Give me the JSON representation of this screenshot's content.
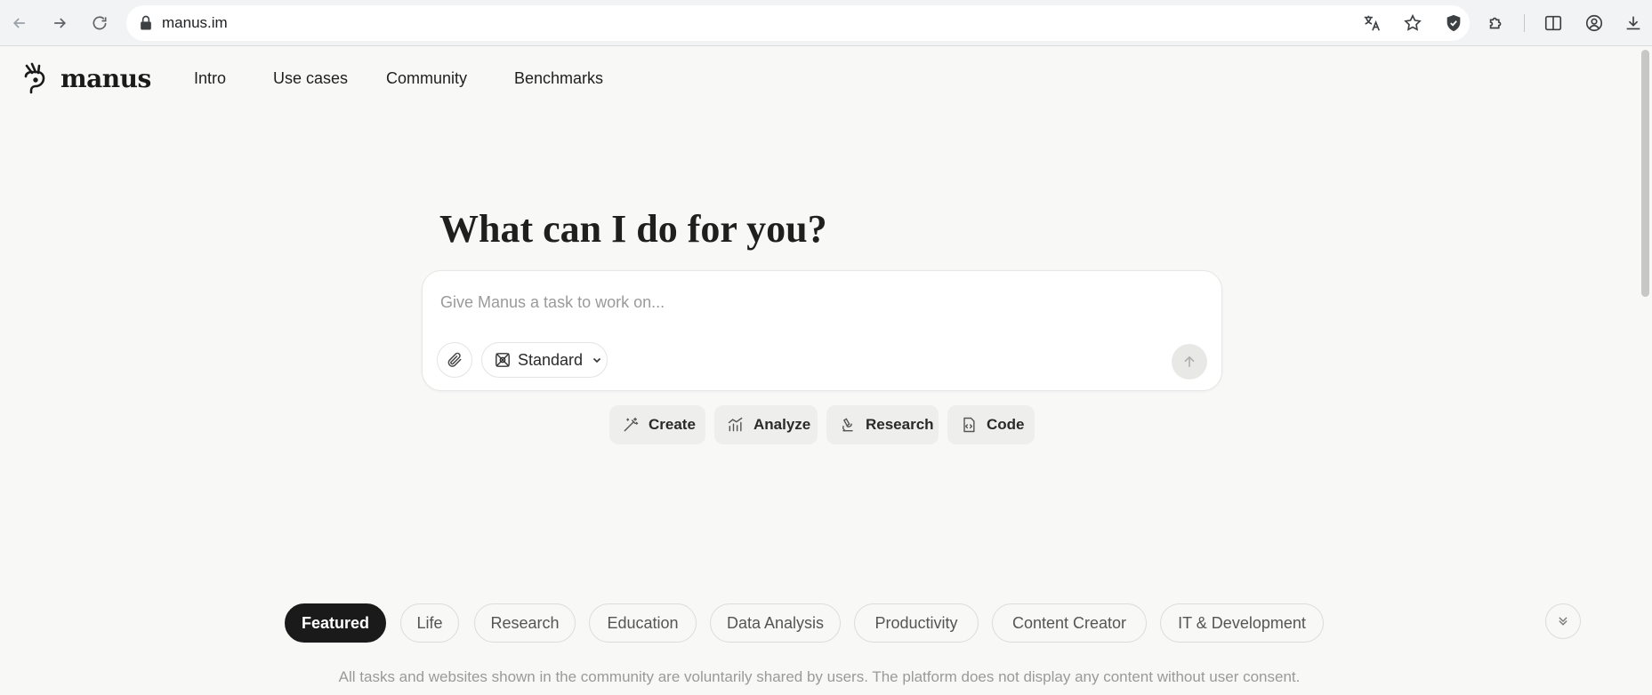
{
  "browser": {
    "url": "manus.im"
  },
  "header": {
    "logo_text": "manus",
    "nav": [
      {
        "label": "Intro"
      },
      {
        "label": "Use cases"
      },
      {
        "label": "Community"
      },
      {
        "label": "Benchmarks"
      }
    ]
  },
  "hero": {
    "title": "What can I do for you?",
    "input_placeholder": "Give Manus a task to work on...",
    "mode_label": "Standard"
  },
  "quick_actions": [
    {
      "label": "Create",
      "icon": "magic-wand-icon"
    },
    {
      "label": "Analyze",
      "icon": "chart-icon"
    },
    {
      "label": "Research",
      "icon": "microscope-icon"
    },
    {
      "label": "Code",
      "icon": "code-file-icon"
    }
  ],
  "categories": [
    {
      "label": "Featured",
      "active": true
    },
    {
      "label": "Life"
    },
    {
      "label": "Research"
    },
    {
      "label": "Education"
    },
    {
      "label": "Data Analysis"
    },
    {
      "label": "Productivity"
    },
    {
      "label": "Content Creator"
    },
    {
      "label": "IT & Development"
    }
  ],
  "disclaimer": "All tasks and websites shown in the community are voluntarily shared by users. The platform does not display any content without user consent."
}
